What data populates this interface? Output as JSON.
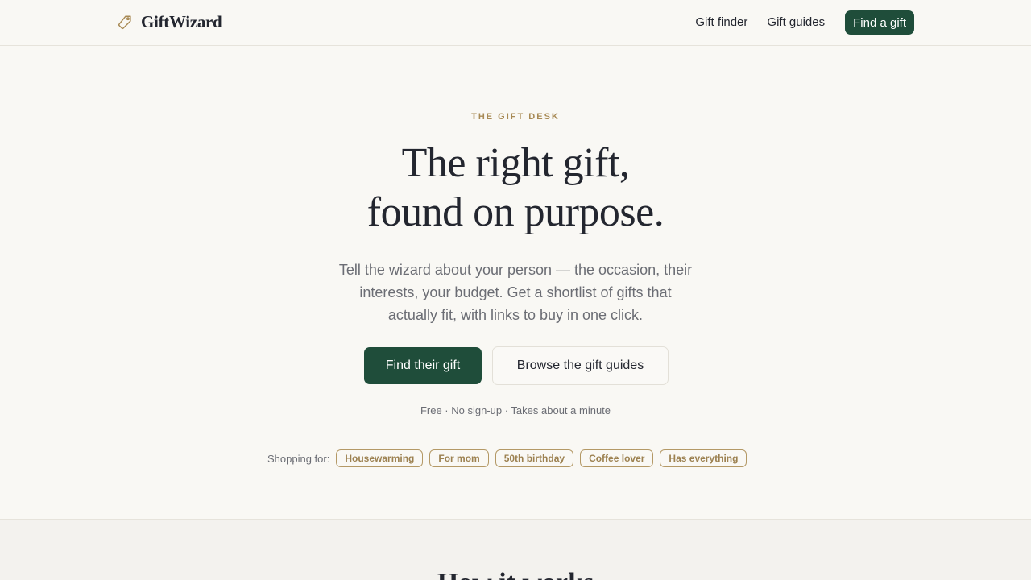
{
  "nav": {
    "brand": "GiftWizard",
    "brand_icon": "tag-icon",
    "links": [
      "Gift finder",
      "Gift guides"
    ],
    "cta": "Find a gift"
  },
  "hero": {
    "eyebrow": "THE GIFT DESK",
    "headline_line1": "The right gift,",
    "headline_line2": "found on purpose.",
    "lede": "Tell the wizard about your person — the occasion, their interests, your budget. Get a shortlist of gifts that actually fit, with links to buy in one click.",
    "primary_cta": "Find their gift",
    "secondary_cta": "Browse the gift guides",
    "fineprint": "Free · No sign-up · Takes about a minute",
    "shopping_for_label": "Shopping for:",
    "chips": [
      "Housewarming",
      "For mom",
      "50th birthday",
      "Coffee lover",
      "Has everything"
    ]
  },
  "how": {
    "title": "How it works"
  },
  "colors": {
    "background": "#f9f8f4",
    "accent_green": "#1f4d3a",
    "accent_gold": "#a88a55",
    "text": "#23262f",
    "muted": "#6b6d74"
  }
}
